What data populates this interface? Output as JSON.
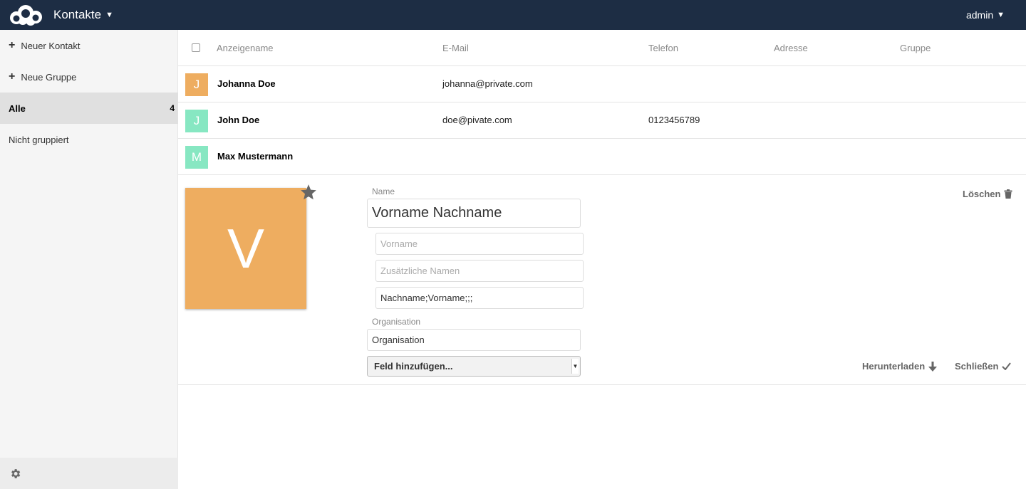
{
  "header": {
    "app_title": "Kontakte",
    "user": "admin"
  },
  "sidebar": {
    "new_contact": "Neuer Kontakt",
    "new_group": "Neue Gruppe",
    "all": {
      "label": "Alle",
      "count": "4"
    },
    "ungrouped": "Nicht gruppiert"
  },
  "table": {
    "columns": [
      "Anzeigename",
      "E-Mail",
      "Telefon",
      "Adresse",
      "Gruppe"
    ],
    "rows": [
      {
        "initial": "J",
        "name": "Johanna Doe",
        "email": "johanna@private.com",
        "phone": "",
        "color": "#eead60"
      },
      {
        "initial": "J",
        "name": "John Doe",
        "email": "doe@pivate.com",
        "phone": "0123456789",
        "color": "#87e7c2"
      },
      {
        "initial": "M",
        "name": "Max Mustermann",
        "email": "",
        "phone": "",
        "color": "#87e7c2"
      }
    ]
  },
  "editor": {
    "avatar_initial": "V",
    "avatar_color": "#eead60",
    "name_label": "Name",
    "fullname_value": "Vorname Nachname",
    "firstname_placeholder": "Vorname",
    "additional_placeholder": "Zusätzliche Namen",
    "structured_value": "Nachname;Vorname;;;",
    "org_label": "Organisation",
    "org_value": "Organisation",
    "add_field": "Feld hinzufügen...",
    "delete": "Löschen",
    "download": "Herunterladen",
    "close": "Schließen"
  }
}
